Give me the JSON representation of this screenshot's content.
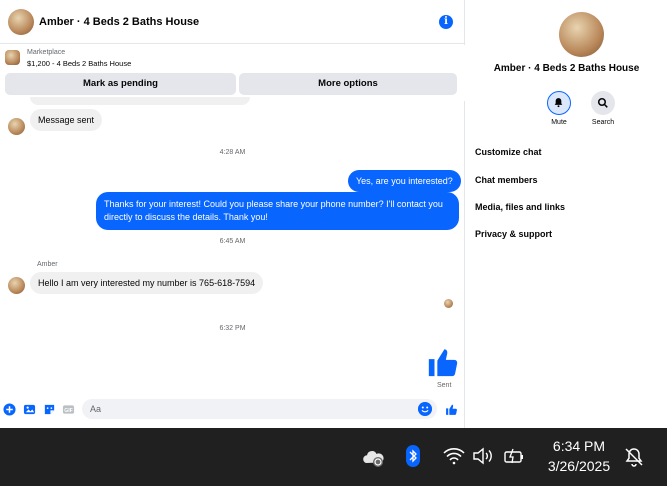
{
  "header": {
    "title": "Amber · 4 Beds 2 Baths House",
    "info_icon": "info-icon"
  },
  "marketplace": {
    "label": "Marketplace",
    "listing": "$1,200 - 4 Beds 2 Baths House"
  },
  "buttons": {
    "pending": "Mark as pending",
    "more": "More options"
  },
  "messages": {
    "m1": "Message sent",
    "ts1": "4:28 AM",
    "m2": "Yes, are you interested?",
    "m3": "Thanks for your interest! Could you please share your phone number? I'll contact you directly to discuss the details. Thank you!",
    "ts2": "6:45 AM",
    "sender": "Amber",
    "m4": "Hello I am very interested my number is 765-618-7594",
    "ts3": "6:32 PM",
    "sent_label": "Sent"
  },
  "composer": {
    "placeholder": "Aa",
    "icons": [
      "plus-icon",
      "image-icon",
      "sticker-icon",
      "gif-icon",
      "emoji-icon",
      "like-icon"
    ]
  },
  "side": {
    "title": "Amber · 4 Beds 2 Baths House",
    "mute_label": "Mute",
    "search_label": "Search",
    "menu": [
      "Customize chat",
      "Chat members",
      "Media, files and links",
      "Privacy & support"
    ]
  },
  "taskbar": {
    "time": "6:34 PM",
    "date": "3/26/2025"
  },
  "colors": {
    "accent": "#0866ff",
    "bubble_in": "#f0f0f0",
    "taskbar": "#202020"
  }
}
